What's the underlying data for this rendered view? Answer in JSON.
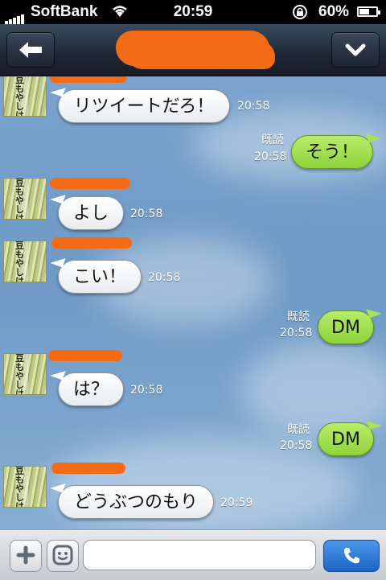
{
  "status_bar": {
    "carrier": "SoftBank",
    "time": "20:59",
    "battery_percent": "60%",
    "battery_level": 0.6
  },
  "header": {
    "back_icon": "back-arrow-icon",
    "menu_icon": "chevron-down-icon"
  },
  "messages": [
    {
      "side": "in",
      "text": "リツイートだろ！",
      "time": "20:58"
    },
    {
      "side": "out",
      "text": "そう！",
      "read": "既読",
      "time": "20:58"
    },
    {
      "side": "in",
      "text": "よし",
      "time": "20:58"
    },
    {
      "side": "in",
      "text": "こい！",
      "time": "20:58"
    },
    {
      "side": "out",
      "text": "DM",
      "read": "既読",
      "time": "20:58"
    },
    {
      "side": "in",
      "text": "は？",
      "time": "20:58"
    },
    {
      "side": "out",
      "text": "DM",
      "read": "既読",
      "time": "20:58"
    },
    {
      "side": "in",
      "text": "どうぶつのもり",
      "time": "20:59"
    }
  ],
  "avatar_text": "豆もやしは",
  "input_bar": {
    "plus_icon": "plus-icon",
    "sticker_icon": "smiley-icon",
    "message_value": "",
    "call_icon": "phone-icon"
  },
  "colors": {
    "out_bubble": "#9ad94a",
    "in_bubble": "#ffffff",
    "redaction": "#f36b17",
    "call_button": "#2f7fdc"
  }
}
